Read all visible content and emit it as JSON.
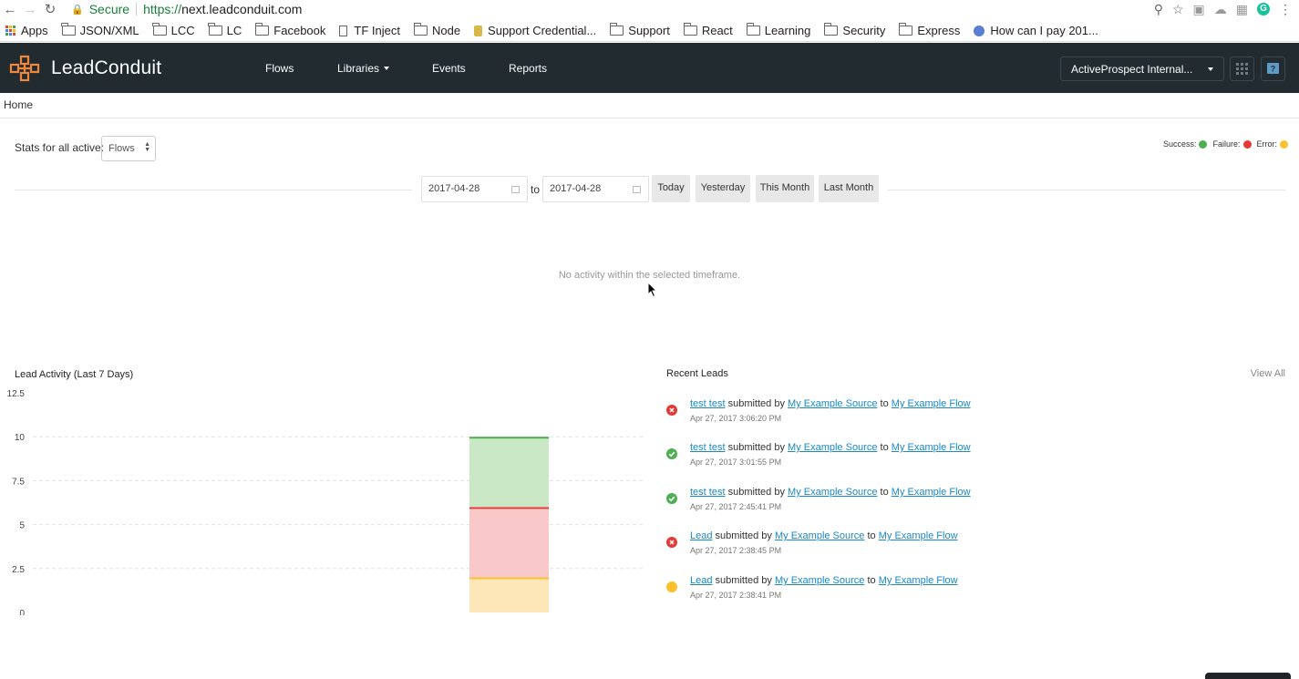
{
  "browser": {
    "secure_label": "Secure",
    "url_scheme": "https://",
    "url_host": "next.leadconduit.com",
    "bookmarks": [
      {
        "label": "Apps",
        "icon": "apps-grid-icon"
      },
      {
        "label": "JSON/XML",
        "icon": "folder-icon"
      },
      {
        "label": "LCC",
        "icon": "folder-icon"
      },
      {
        "label": "LC",
        "icon": "folder-icon"
      },
      {
        "label": "Facebook",
        "icon": "folder-icon"
      },
      {
        "label": "TF Inject",
        "icon": "page-icon"
      },
      {
        "label": "Node",
        "icon": "folder-icon"
      },
      {
        "label": "Support Credential...",
        "icon": "lock-icon"
      },
      {
        "label": "Support",
        "icon": "folder-icon"
      },
      {
        "label": "React",
        "icon": "folder-icon"
      },
      {
        "label": "Learning",
        "icon": "folder-icon"
      },
      {
        "label": "Security",
        "icon": "folder-icon"
      },
      {
        "label": "Express",
        "icon": "folder-icon"
      },
      {
        "label": "How can I pay 201...",
        "icon": "globe-icon"
      }
    ]
  },
  "app": {
    "logo_text": "LeadConduit",
    "nav": [
      "Flows",
      "Libraries",
      "Events",
      "Reports"
    ],
    "account": "ActiveProspect Internal...",
    "brand_color": "#f0873a",
    "header_bg": "#222b30"
  },
  "breadcrumb": "Home",
  "stats": {
    "label": "Stats for all active:",
    "select_value": "Flows",
    "legend": {
      "success": "Success:",
      "failure": "Failure:",
      "error": "Error:"
    },
    "from_date": "2017-04-28",
    "to_label": "to",
    "to_date": "2017-04-28",
    "quick_buttons": [
      "Today",
      "Yesterday",
      "This Month",
      "Last Month"
    ],
    "empty_message": "No activity within the selected timeframe."
  },
  "colors": {
    "success": "#4caf50",
    "failure": "#e53935",
    "error": "#fbc02d",
    "link": "#1a88c9"
  },
  "lead_activity": {
    "title": "Lead Activity (Last 7 Days)"
  },
  "chart_data": {
    "type": "bar",
    "stacked": true,
    "ylim": [
      0,
      12.5
    ],
    "yticks": [
      "0",
      "2.5",
      "5",
      "7.5",
      "10",
      "12.5"
    ],
    "series": [
      {
        "name": "Error",
        "color": "#fbc02d",
        "values": [
          2
        ]
      },
      {
        "name": "Failure",
        "color": "#e53935",
        "values": [
          4
        ]
      },
      {
        "name": "Success",
        "color": "#4caf50",
        "values": [
          4
        ]
      }
    ]
  },
  "recent_leads": {
    "title": "Recent Leads",
    "view_all": "View All",
    "submitted_by": "submitted by",
    "to": "to",
    "items": [
      {
        "status": "failure",
        "lead": "test test",
        "source": "My Example Source",
        "flow": "My Example Flow",
        "time": "Apr 27, 2017 3:06:20 PM"
      },
      {
        "status": "success",
        "lead": "test test",
        "source": "My Example Source",
        "flow": "My Example Flow",
        "time": "Apr 27, 2017 3:01:55 PM"
      },
      {
        "status": "success",
        "lead": "test test",
        "source": "My Example Source",
        "flow": "My Example Flow",
        "time": "Apr 27, 2017 2:45:41 PM"
      },
      {
        "status": "failure",
        "lead": "Lead",
        "source": "My Example Source",
        "flow": "My Example Flow",
        "time": "Apr 27, 2017 2:38:45 PM"
      },
      {
        "status": "error",
        "lead": "Lead",
        "source": "My Example Source",
        "flow": "My Example Flow",
        "time": "Apr 27, 2017 2:38:41 PM"
      }
    ]
  }
}
